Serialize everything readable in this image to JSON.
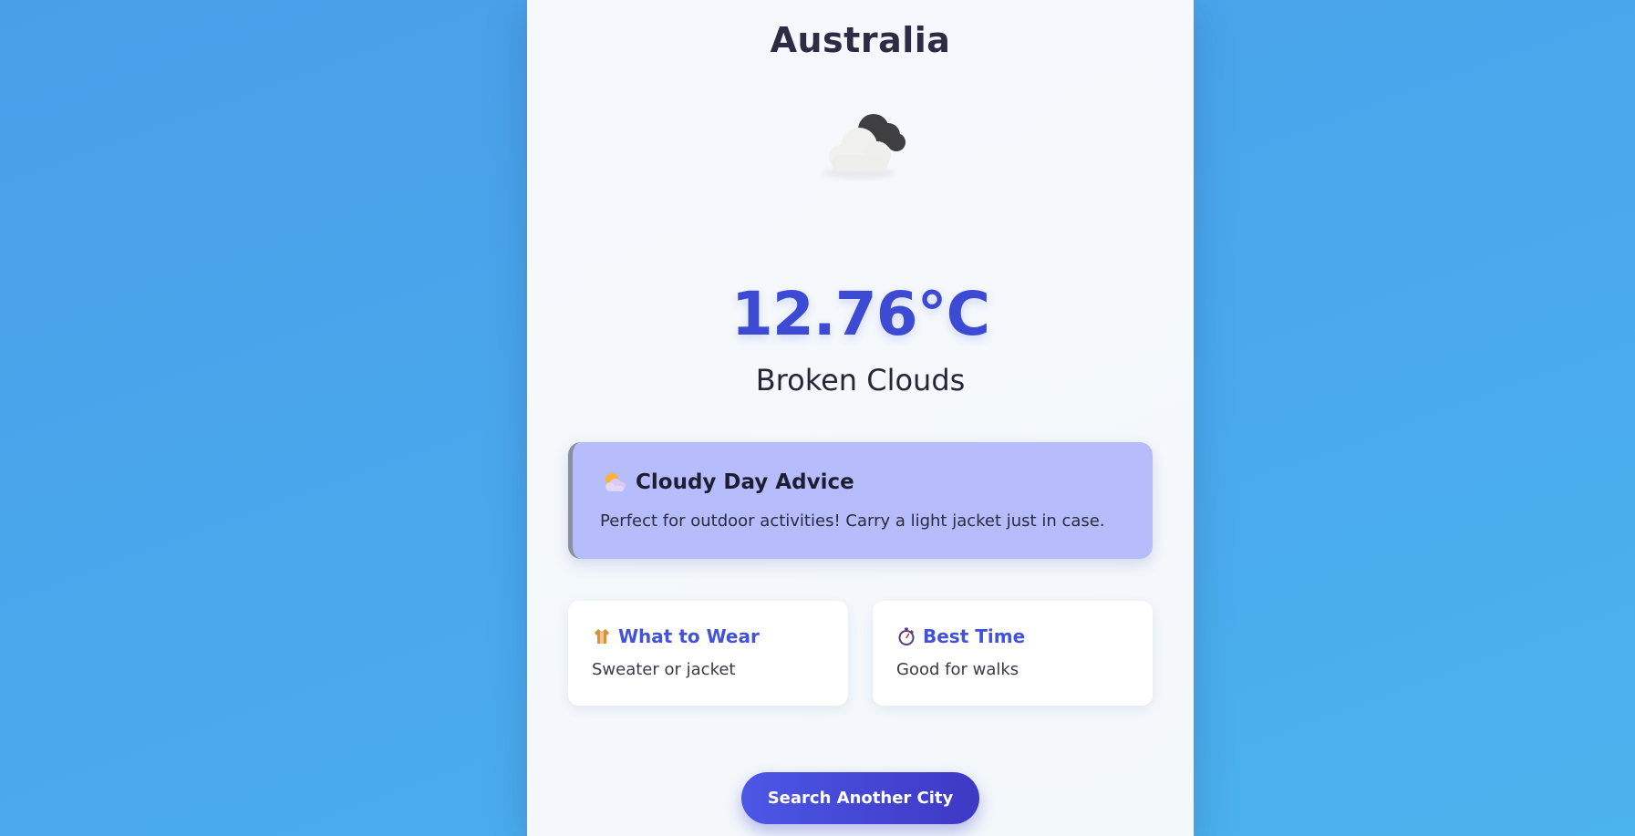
{
  "location": {
    "city": "Australia"
  },
  "current": {
    "temperature": "12.76°C",
    "description": "Broken Clouds",
    "icon": "broken-clouds-icon"
  },
  "advice": {
    "icon": "sun-behind-cloud-icon",
    "title": "Cloudy Day Advice",
    "text": "Perfect for outdoor activities! Carry a light jacket just in case."
  },
  "tiles": [
    {
      "icon": "coat-icon",
      "title": "What to Wear",
      "value": "Sweater or jacket"
    },
    {
      "icon": "stopwatch-icon",
      "title": "Best Time",
      "value": "Good for walks"
    }
  ],
  "actions": {
    "search_label": "Search Another City"
  },
  "colors": {
    "accent": "#3d4bd4",
    "advice_bg": "#b7bdfc",
    "button_gradient_start": "#4c57e6",
    "button_gradient_end": "#3e38c4"
  }
}
